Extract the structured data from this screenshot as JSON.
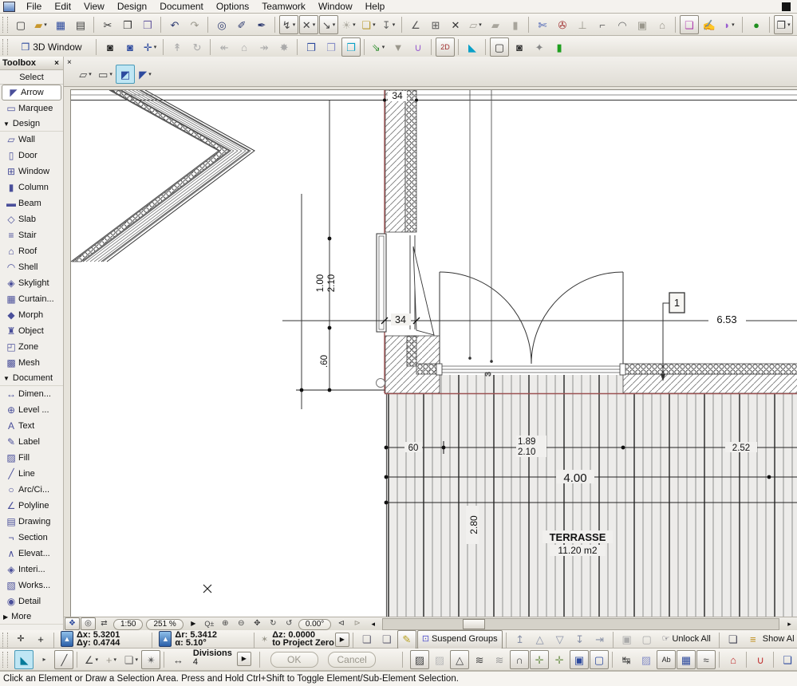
{
  "menu": {
    "items": [
      "File",
      "Edit",
      "View",
      "Design",
      "Document",
      "Options",
      "Teamwork",
      "Window",
      "Help"
    ]
  },
  "toolbar2_label": "3D Window",
  "toolbox": {
    "title": "Toolbox",
    "close": "×",
    "rows": [
      {
        "t": "title2",
        "label": "Select"
      },
      {
        "t": "item",
        "label": "Arrow",
        "n": "arrow",
        "g": "◤",
        "sel": true
      },
      {
        "t": "item",
        "label": "Marquee",
        "n": "marquee",
        "g": "▭"
      },
      {
        "t": "head",
        "label": "Design",
        "tri": "▼"
      },
      {
        "t": "item",
        "label": "Wall",
        "n": "wall",
        "g": "▱"
      },
      {
        "t": "item",
        "label": "Door",
        "n": "door",
        "g": "▯"
      },
      {
        "t": "item",
        "label": "Window",
        "n": "window",
        "g": "⊞"
      },
      {
        "t": "item",
        "label": "Column",
        "n": "column",
        "g": "▮"
      },
      {
        "t": "item",
        "label": "Beam",
        "n": "beam",
        "g": "▬"
      },
      {
        "t": "item",
        "label": "Slab",
        "n": "slab",
        "g": "◇"
      },
      {
        "t": "item",
        "label": "Stair",
        "n": "stair",
        "g": "≡"
      },
      {
        "t": "item",
        "label": "Roof",
        "n": "roof",
        "g": "⌂"
      },
      {
        "t": "item",
        "label": "Shell",
        "n": "shell",
        "g": "◠"
      },
      {
        "t": "item",
        "label": "Skylight",
        "n": "skylight",
        "g": "◈"
      },
      {
        "t": "item",
        "label": "Curtain...",
        "n": "curtain-wall",
        "g": "▦"
      },
      {
        "t": "item",
        "label": "Morph",
        "n": "morph",
        "g": "◆"
      },
      {
        "t": "item",
        "label": "Object",
        "n": "object",
        "g": "♜"
      },
      {
        "t": "item",
        "label": "Zone",
        "n": "zone",
        "g": "◰"
      },
      {
        "t": "item",
        "label": "Mesh",
        "n": "mesh",
        "g": "▩"
      },
      {
        "t": "head",
        "label": "Document",
        "tri": "▼"
      },
      {
        "t": "item",
        "label": "Dimen...",
        "n": "dimension",
        "g": "↔"
      },
      {
        "t": "item",
        "label": "Level ...",
        "n": "level-dimension",
        "g": "⊕"
      },
      {
        "t": "item",
        "label": "Text",
        "n": "text",
        "g": "A"
      },
      {
        "t": "item",
        "label": "Label",
        "n": "label",
        "g": "✎"
      },
      {
        "t": "item",
        "label": "Fill",
        "n": "fill",
        "g": "▨"
      },
      {
        "t": "item",
        "label": "Line",
        "n": "line",
        "g": "╱"
      },
      {
        "t": "item",
        "label": "Arc/Ci...",
        "n": "arc-circle",
        "g": "○"
      },
      {
        "t": "item",
        "label": "Polyline",
        "n": "polyline",
        "g": "∠"
      },
      {
        "t": "item",
        "label": "Drawing",
        "n": "drawing",
        "g": "▤"
      },
      {
        "t": "item",
        "label": "Section",
        "n": "section",
        "g": "¬"
      },
      {
        "t": "item",
        "label": "Elevat...",
        "n": "elevation",
        "g": "∧"
      },
      {
        "t": "item",
        "label": "Interi...",
        "n": "interior-elevation",
        "g": "◈"
      },
      {
        "t": "item",
        "label": "Works...",
        "n": "worksheet",
        "g": "▧"
      },
      {
        "t": "item",
        "label": "Detail",
        "n": "detail",
        "g": "◉"
      },
      {
        "t": "head",
        "label": "More",
        "tri": "▶"
      }
    ]
  },
  "infobox": {
    "close": "×"
  },
  "toolbars": {
    "main": [
      {
        "n": "new-document",
        "g": "▢",
        "c": "#333"
      },
      {
        "n": "open-file",
        "g": "▰",
        "c": "#c8982e",
        "dd": true
      },
      {
        "n": "save",
        "g": "▦",
        "c": "#2d4a9e"
      },
      {
        "n": "print",
        "g": "▤",
        "c": "#444"
      },
      "sep",
      {
        "n": "cut",
        "g": "✂",
        "c": "#333"
      },
      {
        "n": "copy",
        "g": "❐",
        "c": "#333"
      },
      {
        "n": "paste",
        "g": "❒",
        "c": "#6a5ea0"
      },
      "sep",
      {
        "n": "undo",
        "g": "↶",
        "c": "#2d3a70"
      },
      {
        "n": "redo",
        "g": "↷",
        "c": "#9a978c"
      },
      "sep",
      {
        "n": "find-select",
        "g": "◎",
        "c": "#2d3a70"
      },
      {
        "n": "pick-up-parameters",
        "g": "✐",
        "c": "#2d3a70"
      },
      {
        "n": "inject-parameters",
        "g": "✒",
        "c": "#2d3a70"
      },
      "sep",
      {
        "n": "gravity",
        "g": "↯",
        "c": "#444",
        "x": "boxed",
        "dd": true
      },
      {
        "n": "guide-lines",
        "g": "✕",
        "c": "#444",
        "x": "boxed",
        "dd": true
      },
      {
        "n": "cursor-snap-range",
        "g": "↘",
        "c": "#444",
        "x": "boxed",
        "dd": true
      },
      {
        "n": "sun-shadow",
        "g": "☀",
        "c": "#b0ada3",
        "dd": true
      },
      {
        "n": "layer-settings",
        "g": "❏",
        "c": "#b89a30",
        "dd": true
      },
      {
        "n": "pin",
        "g": "↧",
        "c": "#666",
        "dd": true
      },
      "sep",
      {
        "n": "measure",
        "g": "∠",
        "c": "#555"
      },
      {
        "n": "grid-snap",
        "g": "⊞",
        "c": "#555"
      },
      {
        "n": "close-element",
        "g": "✕",
        "c": "#333"
      },
      {
        "n": "slab-tool-gray",
        "g": "▱",
        "c": "#a8a59c",
        "dd": true
      },
      {
        "n": "parallel-tool",
        "g": "▰",
        "c": "#a8a59c"
      },
      {
        "n": "wall-tool-gray",
        "g": "▮",
        "c": "#a8a59c"
      },
      "sep",
      {
        "n": "split",
        "g": "✄",
        "c": "#3a55b0"
      },
      {
        "n": "adjust",
        "g": "✇",
        "c": "#a03030"
      },
      {
        "n": "level-tool",
        "g": "⊥",
        "c": "#9a97:8c"
      },
      {
        "n": "corner-tool",
        "g": "⌐",
        "c": "#666"
      },
      {
        "n": "fillet",
        "g": "◠",
        "c": "#666"
      },
      {
        "n": "resize-box",
        "g": "▣",
        "c": "#9a978c"
      },
      {
        "n": "elevate",
        "g": "⌂",
        "c": "#9a978c"
      },
      "sep",
      {
        "n": "selection-frame",
        "g": "❏",
        "c": "#b040b0",
        "x": "boxed"
      },
      {
        "n": "stamp",
        "g": "✍",
        "c": "#a03030"
      },
      {
        "n": "eraser",
        "g": "◗",
        "c": "#9a5fd0",
        "dd": true
      },
      "sep",
      {
        "n": "teamwork-status",
        "g": "●",
        "c": "#1f8f1f"
      },
      "sep",
      {
        "n": "window-overlay",
        "g": "❐",
        "c": "#333",
        "x": "boxed",
        "dd": true
      },
      {
        "n": "rebuild",
        "g": "↻",
        "c": "#333",
        "dd": true
      },
      {
        "n": "dialog-windows",
        "g": "▣",
        "c": "#333"
      }
    ],
    "view3d": [
      {
        "n": "camera-black",
        "g": "◙",
        "c": "#222"
      },
      {
        "n": "camera-blue",
        "g": "◙",
        "c": "#2d4a9e"
      },
      {
        "n": "3d-axis",
        "g": "✛",
        "c": "#2d4a9e",
        "dd": true
      },
      "sep",
      {
        "n": "walk",
        "g": "↟",
        "c": "#aaa"
      },
      {
        "n": "orbit",
        "g": "↻",
        "c": "#aaa"
      },
      "sep",
      {
        "n": "previous-view",
        "g": "↞",
        "c": "#aaa"
      },
      {
        "n": "home-view",
        "g": "⌂",
        "c": "#aaa"
      },
      {
        "n": "next-view",
        "g": "↠",
        "c": "#aaa"
      },
      {
        "n": "spin-view",
        "g": "✸",
        "c": "#aaa"
      },
      "sep",
      {
        "n": "copy-picture",
        "g": "❐",
        "c": "#2d4a9e"
      },
      {
        "n": "copy-picture-alt",
        "g": "❐",
        "c": "#8a92c8"
      },
      {
        "n": "marquee-3d",
        "g": "❐",
        "c": "#0aa0c8",
        "x": "boxed"
      },
      "sep",
      {
        "n": "3d-cutting-planes",
        "g": "⇘",
        "c": "#2f8f2f",
        "dd": true
      },
      {
        "n": "filter-elements",
        "g": "▼",
        "c": "#9a978c"
      },
      {
        "n": "magnet",
        "g": "∪",
        "c": "#9a5fd0"
      },
      "sep",
      {
        "n": "2d-document",
        "g": "2D",
        "c": "#a03030",
        "fs": 9,
        "x": "boxed"
      },
      "sep",
      {
        "n": "surface-paint",
        "g": "◣",
        "c": "#0aa0c8"
      },
      "sep",
      {
        "n": "screen-capture",
        "g": "▢",
        "c": "#333",
        "x": "boxed"
      },
      {
        "n": "photo-render",
        "g": "◙",
        "c": "#333"
      },
      {
        "n": "render-wand",
        "g": "✦",
        "c": "#888"
      },
      {
        "n": "render-flag",
        "g": "▮",
        "c": "#1f9f1f"
      }
    ],
    "infobox_items": [
      {
        "n": "polygon-selection",
        "g": "▱",
        "c": "#444",
        "dd": true
      },
      {
        "n": "marquee-selection",
        "g": "▭",
        "c": "#444",
        "dd": true
      },
      {
        "n": "quick-selection",
        "g": "◩",
        "c": "#2d4a9e",
        "x": "cyan"
      },
      {
        "n": "arrow-tool",
        "g": "◤",
        "c": "#2d4a9e",
        "dd": true
      }
    ],
    "nav_left": [
      {
        "n": "bookmark-view",
        "g": "❖",
        "c": "#2d4a9e",
        "x": "boxed"
      },
      {
        "n": "zoom-preview",
        "g": "◎",
        "c": "#444",
        "x": "boxed"
      },
      {
        "n": "swap-view",
        "g": "⇄",
        "c": "#444"
      }
    ],
    "nav_zoom": [
      {
        "n": "zoom-options",
        "g": "Q±",
        "c": "#444",
        "fs": 9
      },
      {
        "n": "zoom-in",
        "g": "⊕",
        "c": "#444"
      },
      {
        "n": "zoom-out",
        "g": "⊖",
        "c": "#444"
      },
      {
        "n": "pan",
        "g": "✥",
        "c": "#444"
      },
      {
        "n": "orbit-2d",
        "g": "↻",
        "c": "#444"
      },
      {
        "n": "rotate-view",
        "g": "↺",
        "c": "#444"
      }
    ],
    "nav_fit": [
      {
        "n": "zoom-previous",
        "g": "⊲",
        "c": "#444"
      },
      {
        "n": "zoom-next",
        "g": "⊳",
        "c": "#9a978c"
      }
    ],
    "tracker_right": [
      {
        "n": "group",
        "g": "❏",
        "c": "#667"
      },
      {
        "n": "ungroup",
        "g": "❏",
        "c": "#667"
      },
      {
        "n": "autogroup",
        "g": "✎",
        "c": "#b8a020",
        "x": "boxed"
      }
    ],
    "arrange": [
      {
        "n": "bring-to-front",
        "g": "↥",
        "c": "#8a92a8"
      },
      {
        "n": "bring-forward",
        "g": "△",
        "c": "#8a92a8"
      },
      {
        "n": "send-backward",
        "g": "▽",
        "c": "#8a92a8"
      },
      {
        "n": "send-to-back",
        "g": "↧",
        "c": "#8a92a8"
      },
      {
        "n": "order-reset",
        "g": "⇥",
        "c": "#8a92a8"
      },
      "sep",
      {
        "n": "lock",
        "g": "▣",
        "c": "#aaa"
      },
      {
        "n": "unlock",
        "g": "▢",
        "c": "#aaa"
      }
    ],
    "layerend": [
      {
        "n": "renovation-filter",
        "g": "❏",
        "c": "#445"
      },
      {
        "n": "layers-show",
        "g": "≡",
        "c": "#c09020"
      }
    ],
    "edit_left": [
      {
        "n": "selection-settings",
        "g": "◣",
        "c": "#067a9a",
        "x": "cyan"
      },
      {
        "n": "expand-panel",
        "g": "▸",
        "c": "#444",
        "fs": 8
      },
      {
        "n": "line-geometry",
        "g": "╱",
        "c": "#444",
        "x": "boxed"
      },
      "sep",
      {
        "n": "angle-input",
        "g": "∠",
        "c": "#444",
        "dd": true
      },
      {
        "n": "offset-input",
        "g": "+",
        "c": "#9a978c",
        "dd": true
      },
      {
        "n": "multiply-nodes",
        "g": "❏",
        "c": "#666",
        "dd": true
      },
      {
        "n": "magic-wand",
        "g": "✴",
        "c": "#666",
        "x": "boxed"
      },
      "sep",
      {
        "n": "divisions-dim",
        "g": "↔",
        "c": "#444"
      }
    ],
    "edit_right": [
      {
        "n": "fill-hatch",
        "g": "▨",
        "c": "#444",
        "x": "boxed"
      },
      {
        "n": "fill-background",
        "g": "▨",
        "c": "#bbb"
      },
      {
        "n": "trapezoid-wall",
        "g": "△",
        "c": "#444",
        "x": "boxed"
      },
      {
        "n": "zigzag-line",
        "g": "≋",
        "c": "#444"
      },
      {
        "n": "zigzag-line-alt",
        "g": "≋",
        "c": "#999"
      },
      {
        "n": "curved-segment",
        "g": "∩",
        "c": "#444",
        "x": "boxed"
      },
      {
        "n": "gravity-target",
        "g": "✛",
        "c": "#7a9a5a",
        "x": "boxed"
      },
      {
        "n": "gravity-target-alt",
        "g": "✛",
        "c": "#7a9a5a"
      },
      {
        "n": "door-plan-display",
        "g": "▣",
        "c": "#2d4a9e",
        "x": "boxed"
      },
      {
        "n": "window-plan-display",
        "g": "▢",
        "c": "#2d4a9e",
        "x": "boxed"
      },
      "sep",
      {
        "n": "stretch",
        "g": "↹",
        "c": "#444"
      },
      {
        "n": "hatch-orientation",
        "g": "▨",
        "c": "#8a92c8"
      },
      {
        "n": "text-favorites",
        "g": "Ab",
        "c": "#222",
        "fs": 9,
        "x": "boxed"
      },
      {
        "n": "figure-tool",
        "g": "▦",
        "c": "#2d4a9e",
        "x": "boxed"
      },
      {
        "n": "spline-tool",
        "g": "≈",
        "c": "#444",
        "x": "boxed"
      },
      "sep",
      {
        "n": "roof-pitch",
        "g": "⌂",
        "c": "#c03030"
      },
      "sep",
      {
        "n": "protection-shield",
        "g": "∪",
        "c": "#c03030"
      },
      "sep",
      {
        "n": "display-options",
        "g": "❏",
        "c": "#2d4a9e"
      }
    ]
  },
  "nav": {
    "scale": "1:50",
    "zoom": "251 %",
    "angle": "0.00°",
    "more": "▶",
    "scroll_left": "◂",
    "scroll_right": "▸"
  },
  "tracker": {
    "dx_label": "Δx:",
    "dx": "5.3201",
    "dy_label": "Δy:",
    "dy": "0.4744",
    "dr_label": "Δr:",
    "dr": "5.3412",
    "a_label": "α:",
    "a": "5.10°",
    "dz_label": "Δz:",
    "dz": "0.0000",
    "ref": "to Project Zero"
  },
  "groupbar": {
    "suspend": "Suspend Groups",
    "unlock_all": "Unlock All",
    "show": "Show Al"
  },
  "editbar": {
    "divisions": "Divisions",
    "divisions_value": "4",
    "ok": "OK",
    "cancel": "Cancel"
  },
  "statusbar": {
    "message": "Click an Element or Draw a Selection Area. Press and Hold Ctrl+Shift to Toggle Element/Sub-Element Selection."
  },
  "drawing": {
    "dims": {
      "wall_top": "34",
      "wall_window": "34",
      "span": "6.53",
      "window_w": "1.00",
      "window_h": "2.10",
      "parapet": ".60",
      "deck_60": "60",
      "door_w": "1.89",
      "door_h": "2.10",
      "deck_252": "2.52",
      "deck_400": "4.00",
      "deck_280": "2.80",
      "small_3": "3"
    },
    "labels": {
      "zone_name": "TERRASSE",
      "zone_area": "11.20 m2",
      "marker": "1"
    }
  }
}
